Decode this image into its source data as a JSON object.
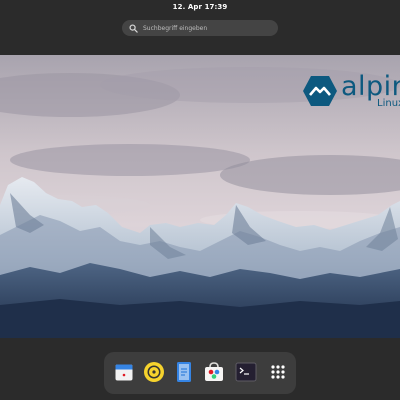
{
  "topbar": {
    "clock": "12. Apr  17:39"
  },
  "search": {
    "placeholder": "Suchbegriff eingeben",
    "icon": "search-icon"
  },
  "workspace": {
    "wallpaper": "snow-mountains",
    "logo": {
      "word": "alpine",
      "sub": "Linux"
    }
  },
  "dock": {
    "items": [
      {
        "name": "calendar",
        "icon": "calendar-icon"
      },
      {
        "name": "rhythmbox",
        "icon": "music-player-icon"
      },
      {
        "name": "text-editor",
        "icon": "text-editor-icon"
      },
      {
        "name": "software",
        "icon": "software-store-icon"
      },
      {
        "name": "terminal",
        "icon": "terminal-icon"
      },
      {
        "name": "show-applications",
        "icon": "app-grid-icon"
      }
    ]
  },
  "colors": {
    "background": "#2b2b2b",
    "dock": "#3d3d3d",
    "search": "#444444",
    "logo": "#0d597f"
  }
}
